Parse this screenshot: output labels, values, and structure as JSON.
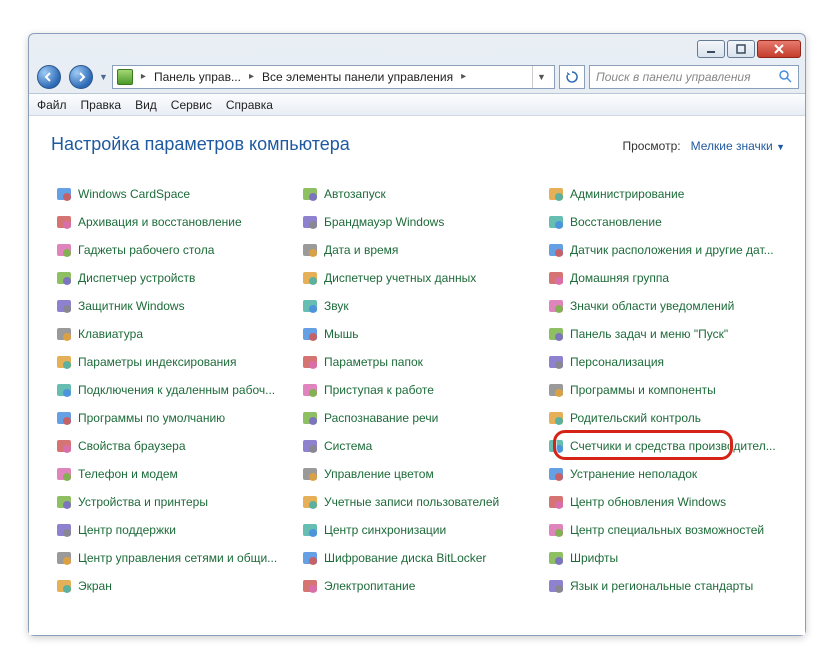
{
  "titlebar": {
    "minimize": "_",
    "maximize": "□",
    "close": "×"
  },
  "address": {
    "root": "Панель управ...",
    "current": "Все элементы панели управления"
  },
  "search": {
    "placeholder": "Поиск в панели управления"
  },
  "menus": {
    "file": "Файл",
    "edit": "Правка",
    "view": "Вид",
    "service": "Сервис",
    "help": "Справка"
  },
  "header": {
    "title": "Настройка параметров компьютера",
    "view_label": "Просмотр:",
    "view_value": "Мелкие значки"
  },
  "icon_colors": [
    "#4a8fe0",
    "#7ab548",
    "#e0a23a",
    "#cf5a5a",
    "#7a6bc7",
    "#4bb1a5",
    "#d96fb0",
    "#888888"
  ],
  "items": [
    {
      "label": "Windows CardSpace",
      "icon": "cardspace-icon"
    },
    {
      "label": "Автозапуск",
      "icon": "autoplay-icon"
    },
    {
      "label": "Администрирование",
      "icon": "admin-icon"
    },
    {
      "label": "Архивация и восстановление",
      "icon": "backup-icon"
    },
    {
      "label": "Брандмауэр Windows",
      "icon": "firewall-icon"
    },
    {
      "label": "Восстановление",
      "icon": "recovery-icon"
    },
    {
      "label": "Гаджеты рабочего стола",
      "icon": "gadgets-icon"
    },
    {
      "label": "Дата и время",
      "icon": "datetime-icon"
    },
    {
      "label": "Датчик расположения и другие дат...",
      "icon": "sensor-icon"
    },
    {
      "label": "Диспетчер устройств",
      "icon": "device-manager-icon"
    },
    {
      "label": "Диспетчер учетных данных",
      "icon": "credential-icon"
    },
    {
      "label": "Домашняя группа",
      "icon": "homegroup-icon"
    },
    {
      "label": "Защитник Windows",
      "icon": "defender-icon"
    },
    {
      "label": "Звук",
      "icon": "sound-icon"
    },
    {
      "label": "Значки области уведомлений",
      "icon": "tray-icon"
    },
    {
      "label": "Клавиатура",
      "icon": "keyboard-icon"
    },
    {
      "label": "Мышь",
      "icon": "mouse-icon"
    },
    {
      "label": "Панель задач и меню \"Пуск\"",
      "icon": "taskbar-icon"
    },
    {
      "label": "Параметры индексирования",
      "icon": "indexing-icon"
    },
    {
      "label": "Параметры папок",
      "icon": "folder-options-icon"
    },
    {
      "label": "Персонализация",
      "icon": "personalization-icon"
    },
    {
      "label": "Подключения к удаленным рабоч...",
      "icon": "remote-icon"
    },
    {
      "label": "Приступая к работе",
      "icon": "getting-started-icon"
    },
    {
      "label": "Программы и компоненты",
      "icon": "programs-icon"
    },
    {
      "label": "Программы по умолчанию",
      "icon": "default-programs-icon"
    },
    {
      "label": "Распознавание речи",
      "icon": "speech-icon"
    },
    {
      "label": "Родительский контроль",
      "icon": "parental-icon"
    },
    {
      "label": "Свойства браузера",
      "icon": "internet-options-icon"
    },
    {
      "label": "Система",
      "icon": "system-icon"
    },
    {
      "label": "Счетчики и средства производител...",
      "icon": "performance-icon"
    },
    {
      "label": "Телефон и модем",
      "icon": "phone-icon"
    },
    {
      "label": "Управление цветом",
      "icon": "color-mgmt-icon"
    },
    {
      "label": "Устранение неполадок",
      "icon": "troubleshoot-icon"
    },
    {
      "label": "Устройства и принтеры",
      "icon": "devices-printers-icon"
    },
    {
      "label": "Учетные записи пользователей",
      "icon": "user-accounts-icon"
    },
    {
      "label": "Центр обновления Windows",
      "icon": "windows-update-icon"
    },
    {
      "label": "Центр поддержки",
      "icon": "action-center-icon"
    },
    {
      "label": "Центр синхронизации",
      "icon": "sync-center-icon"
    },
    {
      "label": "Центр специальных возможностей",
      "icon": "ease-access-icon"
    },
    {
      "label": "Центр управления сетями и общи...",
      "icon": "network-center-icon"
    },
    {
      "label": "Шифрование диска BitLocker",
      "icon": "bitlocker-icon"
    },
    {
      "label": "Шрифты",
      "icon": "fonts-icon"
    },
    {
      "label": "Экран",
      "icon": "display-icon"
    },
    {
      "label": "Электропитание",
      "icon": "power-icon"
    },
    {
      "label": "Язык и региональные стандарты",
      "icon": "region-icon"
    }
  ]
}
